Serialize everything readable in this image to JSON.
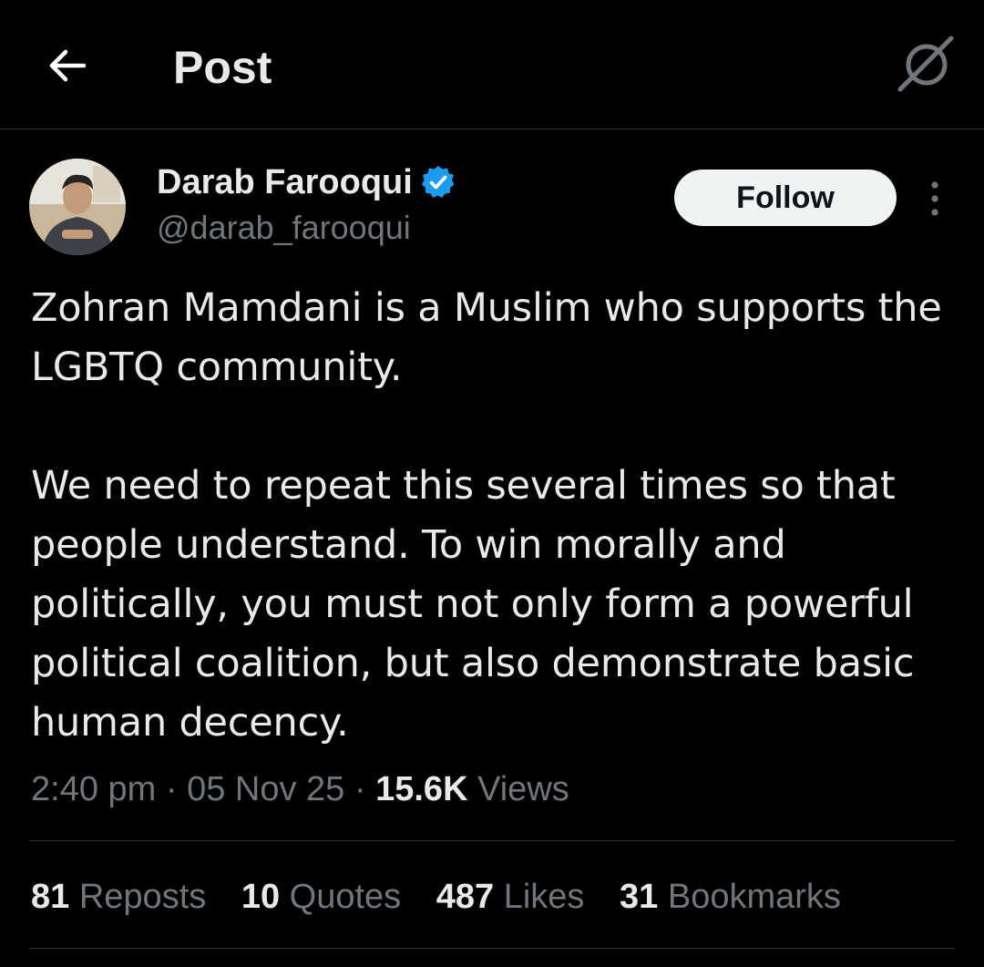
{
  "header": {
    "back_icon": "arrow-left-icon",
    "title": "Post",
    "grok_icon": "grok-icon"
  },
  "author": {
    "display_name": "Darab Farooqui",
    "handle": "@darab_farooqui",
    "verified": true,
    "verified_color": "#1d9bf0",
    "avatar": "avatar"
  },
  "actions": {
    "follow_label": "Follow",
    "more_icon": "more-vertical-icon"
  },
  "post": {
    "paragraphs": [
      "Zohran Mamdani is a Muslim who supports the LGBTQ community.",
      "We need to repeat this several times so that people understand. To win morally and politically, you must not only form a powerful political coalition, but also demonstrate basic human decency."
    ],
    "time": "2:40 pm",
    "date": "05 Nov 25",
    "views_count": "15.6K",
    "views_label": "Views"
  },
  "stats": [
    {
      "count": "81",
      "label": "Reposts"
    },
    {
      "count": "10",
      "label": "Quotes"
    },
    {
      "count": "487",
      "label": "Likes"
    },
    {
      "count": "31",
      "label": "Bookmarks"
    }
  ],
  "colors": {
    "background": "#000000",
    "text": "#e7e9ea",
    "secondary_text": "#71767b",
    "divider": "#2f3336",
    "follow_button_bg": "#eff3f4"
  }
}
